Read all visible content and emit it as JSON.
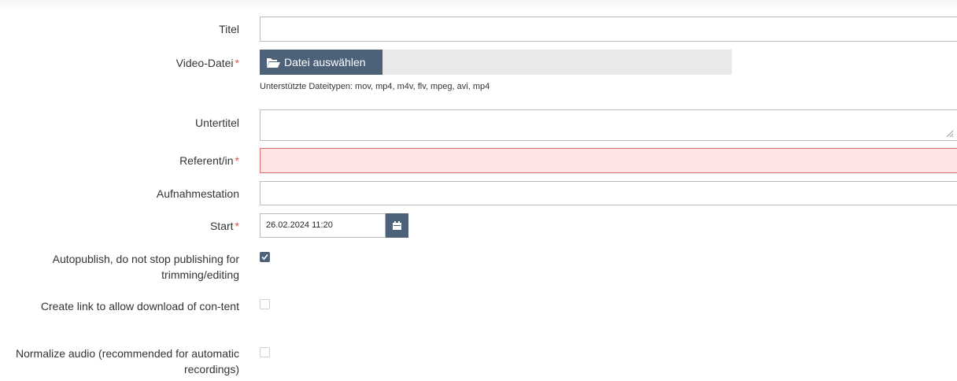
{
  "form": {
    "title": {
      "label": "Titel",
      "value": ""
    },
    "video": {
      "label": "Video-Datei",
      "required_mark": "*",
      "button_label": "Datei auswählen",
      "hint": "Unterstützte Dateitypen: mov, mp4, m4v, flv, mpeg, avi, mp4"
    },
    "subtitle": {
      "label": "Untertitel",
      "value": ""
    },
    "speaker": {
      "label": "Referent/in",
      "required_mark": "*",
      "value": ""
    },
    "station": {
      "label": "Aufnahmestation",
      "value": ""
    },
    "start": {
      "label": "Start",
      "required_mark": "*",
      "value": "26.02.2024 11:20"
    },
    "autopublish": {
      "label": "Autopublish, do not stop publishing for trimming/editing",
      "checked": true
    },
    "download_link": {
      "label": "Create link to allow download of con-tent",
      "checked": false
    },
    "normalize_audio": {
      "label": "Normalize audio (recommended for automatic recordings)",
      "checked": false
    }
  },
  "icons": {
    "folder": "folder-open-icon",
    "calendar": "calendar-icon",
    "check": "check-icon"
  },
  "colors": {
    "accent": "#4d6279",
    "error_bg": "#fde5e5",
    "error_border": "#dd6b6b",
    "required": "#d9534f"
  }
}
